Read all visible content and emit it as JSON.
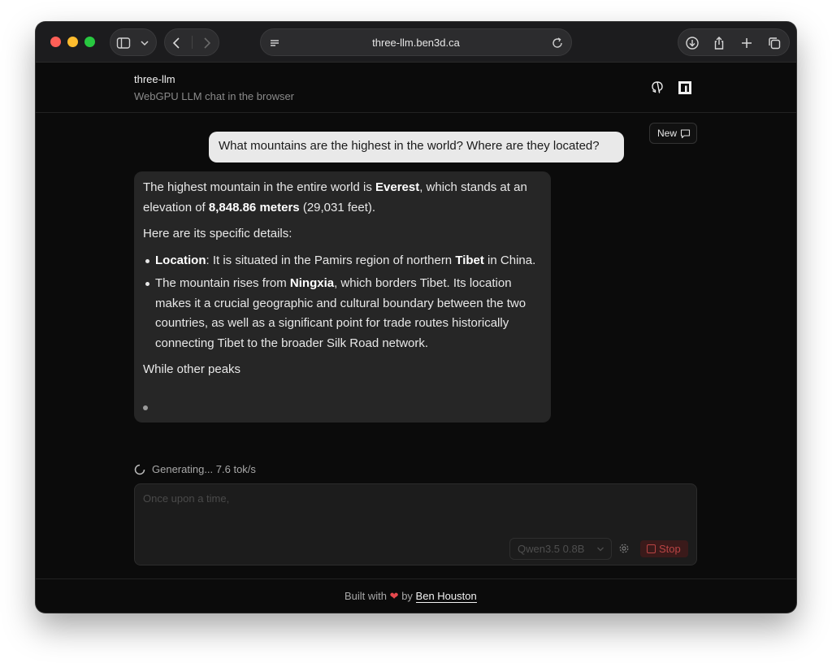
{
  "browser": {
    "url": "three-llm.ben3d.ca",
    "icons": [
      "sidebar-icon",
      "chevron-down-icon",
      "back-arrow-icon",
      "forward-arrow-icon",
      "page-menu-icon",
      "reload-icon",
      "download-icon",
      "share-icon",
      "new-tab-icon",
      "tabs-overview-icon"
    ]
  },
  "app": {
    "title": "three-llm",
    "subtitle": "WebGPU LLM chat in the browser",
    "header_icons": [
      "github-icon",
      "npm-icon"
    ]
  },
  "chat": {
    "new_button_label": "New",
    "user_message": "What mountains are the highest in the world?  Where are they located?",
    "assistant": {
      "p1_a": "The highest mountain in the entire world is ",
      "p1_b1": "Everest",
      "p1_c": ", which stands at an elevation of ",
      "p1_b2": "8,848.86 meters",
      "p1_d": " (29,031 feet).",
      "p2": "Here are its specific details:",
      "li1_b": "Location",
      "li1_a": ": It is situated in the Pamirs region of northern ",
      "li1_b2": "Tibet",
      "li1_c": " in China.",
      "li2_a": "The mountain rises from ",
      "li2_b": "Ningxia",
      "li2_c": ", which borders Tibet. Its location makes it a crucial geographic and cultural boundary between the two countries, as well as a significant point for trade routes historically connecting Tibet to the broader Silk Road network.",
      "p3": "While other peaks"
    }
  },
  "status": {
    "text": "Generating... 7.6 tok/s"
  },
  "composer": {
    "placeholder": "Once upon a time,",
    "model": "Qwen3.5 0.8B",
    "stop_label": "Stop"
  },
  "footer": {
    "prefix": "Built with",
    "heart": "❤",
    "by": "by",
    "author": "Ben Houston"
  },
  "colors": {
    "background": "#0b0b0b",
    "user_bubble": "#e9e9e9",
    "assistant_bubble": "#262626",
    "stop": "#b94444",
    "heart": "#e5484d"
  }
}
